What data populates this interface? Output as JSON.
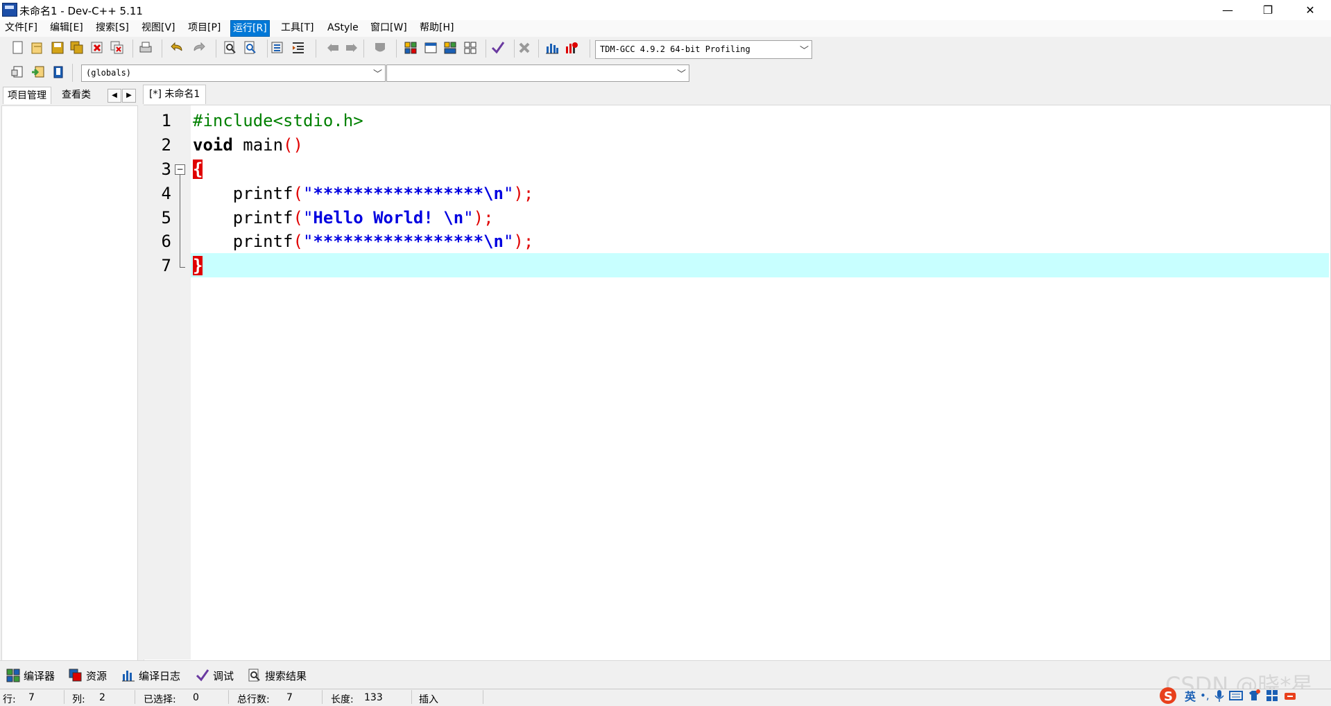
{
  "window": {
    "title": "未命名1 - Dev-C++ 5.11",
    "minimize": "—",
    "restore": "❐",
    "close": "✕"
  },
  "menu": [
    "文件[F]",
    "编辑[E]",
    "搜索[S]",
    "视图[V]",
    "项目[P]",
    "运行[R]",
    "工具[T]",
    "AStyle",
    "窗口[W]",
    "帮助[H]"
  ],
  "menu_active": "运行[R]",
  "toolbar": {
    "compiler_select": "TDM-GCC 4.9.2 64-bit Profiling",
    "scope_select": "(globals)",
    "member_select": ""
  },
  "left_tabs": [
    "项目管理",
    "查看类"
  ],
  "editor": {
    "tab_label": "[*] 未命名1",
    "line_numbers": [
      "1",
      "2",
      "3",
      "4",
      "5",
      "6",
      "7"
    ],
    "lines": [
      "#include<stdio.h>",
      "void main()",
      "{",
      "    printf(\"*****************\\n\");",
      "    printf(\"Hello World! \\n\");",
      "    printf(\"*****************\\n\");",
      "}"
    ],
    "highlighted_line": 7,
    "colors": {
      "preprocessor": "#008000",
      "string": "#0000e0",
      "paren": "#e00000",
      "current_line": "#c8ffff",
      "brace_match_bg": "#e00000"
    }
  },
  "bottom_tabs": [
    {
      "label": "编译器",
      "icon": "grid-icon"
    },
    {
      "label": "资源",
      "icon": "resources-icon"
    },
    {
      "label": "编译日志",
      "icon": "chart-icon"
    },
    {
      "label": "调试",
      "icon": "check-icon"
    },
    {
      "label": "搜索结果",
      "icon": "search-results-icon"
    }
  ],
  "status": {
    "row_label": "行:",
    "row_value": "7",
    "col_label": "列:",
    "col_value": "2",
    "sel_label": "已选择:",
    "sel_value": "0",
    "lines_label": "总行数:",
    "lines_value": "7",
    "len_label": "长度:",
    "len_value": "133",
    "mode": "插入"
  },
  "watermark": "CSDN @晓*星",
  "ime": {
    "lang": "英"
  }
}
